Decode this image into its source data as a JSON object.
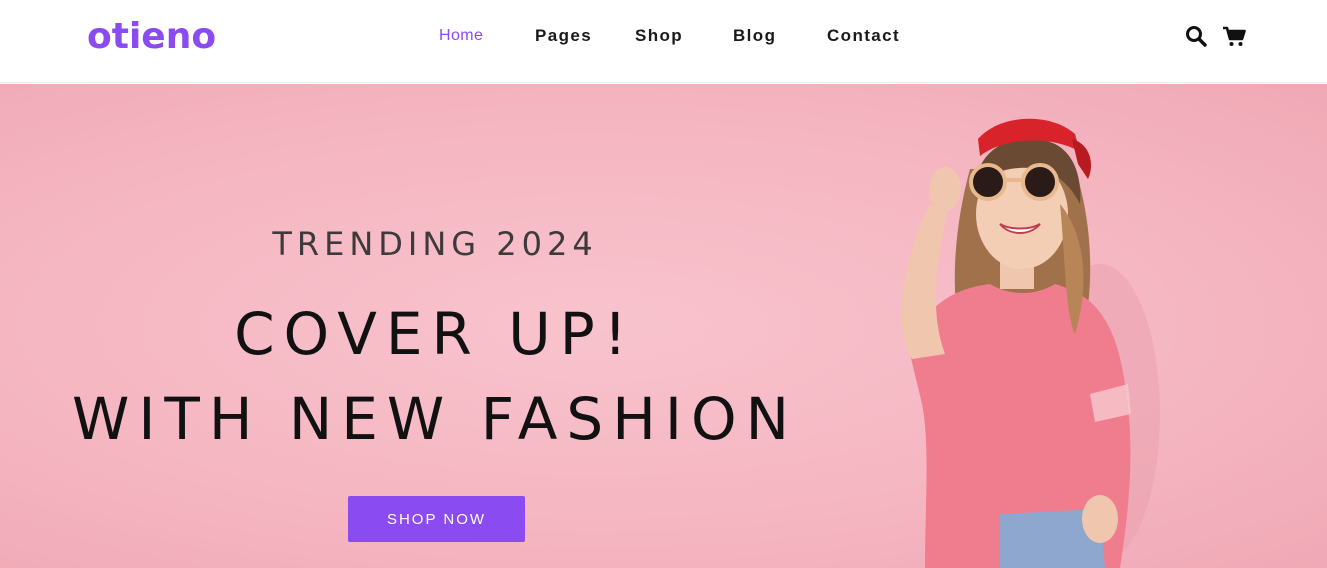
{
  "brand": {
    "logo_text": "otieno",
    "accent_color": "#8a4cf0"
  },
  "nav": {
    "items": [
      {
        "label": "Home",
        "active": true
      },
      {
        "label": "Pages",
        "active": false
      },
      {
        "label": "Shop",
        "active": false
      },
      {
        "label": "Blog",
        "active": false
      },
      {
        "label": "Contact",
        "active": false
      }
    ]
  },
  "header_icons": {
    "search": "search-icon",
    "cart": "cart-icon"
  },
  "hero": {
    "eyebrow": "TRENDING 2024",
    "headline_line1": "COVER UP!",
    "headline_line2": "WITH NEW FASHION",
    "cta_label": "SHOP NOW",
    "background_color": "#f5b7c2"
  }
}
